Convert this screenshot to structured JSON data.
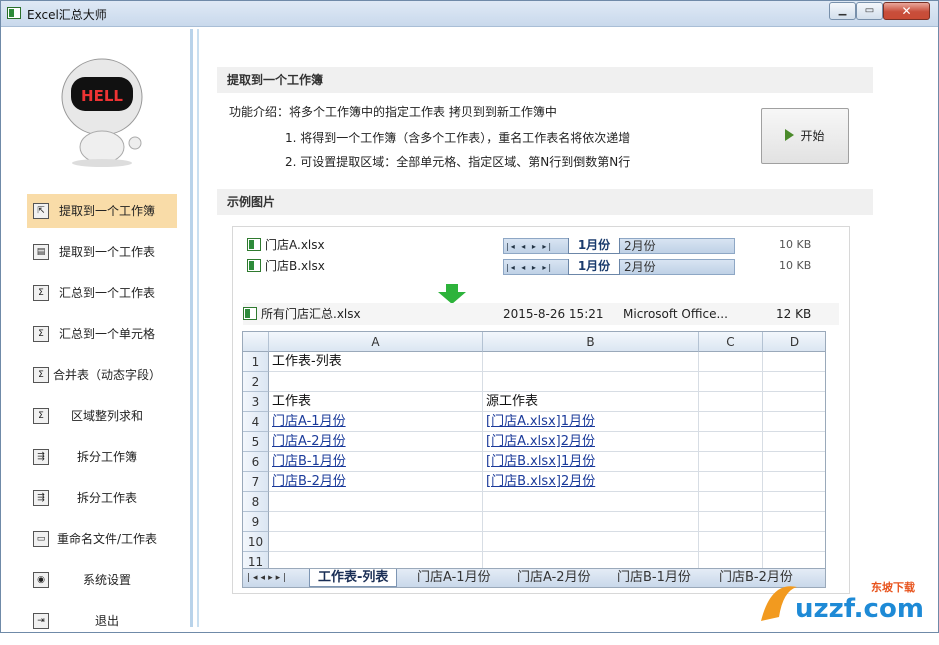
{
  "window": {
    "title": "Excel汇总大师",
    "close_glyph": "✕",
    "min_glyph": "▁",
    "max_glyph": "▭"
  },
  "sidebar": {
    "robot_text": "HELL",
    "items": [
      {
        "label": "提取到一个工作簿",
        "icon": "extract-workbook-icon",
        "glyph": "⇱",
        "active": true
      },
      {
        "label": "提取到一个工作表",
        "icon": "extract-sheet-icon",
        "glyph": "▤"
      },
      {
        "label": "汇总到一个工作表",
        "icon": "sigma-icon",
        "glyph": "Σ"
      },
      {
        "label": "汇总到一个单元格",
        "icon": "sigma-icon",
        "glyph": "Σ"
      },
      {
        "label": "合并表（动态字段）",
        "icon": "sigma-icon",
        "glyph": "Σ"
      },
      {
        "label": "区域整列求和",
        "icon": "sigma-icon",
        "glyph": "Σ"
      },
      {
        "label": "拆分工作簿",
        "icon": "split-icon",
        "glyph": "⇶"
      },
      {
        "label": "拆分工作表",
        "icon": "split-icon",
        "glyph": "⇶"
      },
      {
        "label": "重命名文件/工作表",
        "icon": "rename-icon",
        "glyph": "▭"
      },
      {
        "label": "系统设置",
        "icon": "settings-icon",
        "glyph": "◉"
      },
      {
        "label": "退出",
        "icon": "exit-icon",
        "glyph": "⇥"
      }
    ]
  },
  "main": {
    "section1_title": "提取到一个工作簿",
    "intro": "功能介绍：将多个工作簿中的指定工作表 拷贝到到新工作簿中",
    "bullet1": "1. 将得到一个工作簿（含多个工作表），重名工作表名将依次递增",
    "bullet2": "2. 可设置提取区域：全部单元格、指定区域、第N行到倒数第N行",
    "start_label": "开始",
    "section2_title": "示例图片"
  },
  "example": {
    "files": [
      {
        "name": "门店A.xlsx",
        "tab1": "1月份",
        "tab2": "2月份",
        "size": "10 KB"
      },
      {
        "name": "门店B.xlsx",
        "tab1": "1月份",
        "tab2": "2月份",
        "size": "10 KB"
      }
    ],
    "summary": {
      "name": "所有门店汇总.xlsx",
      "date": "2015-8-26 15:21",
      "type": "Microsoft Office...",
      "size": "12 KB"
    },
    "columns": [
      "A",
      "B",
      "C",
      "D"
    ],
    "rows": [
      {
        "n": "1",
        "a": "工作表-列表",
        "b": "",
        "link": false
      },
      {
        "n": "2",
        "a": "",
        "b": "",
        "link": false
      },
      {
        "n": "3",
        "a": "工作表",
        "b": "源工作表",
        "link": false
      },
      {
        "n": "4",
        "a": "门店A-1月份",
        "b": "[门店A.xlsx]1月份",
        "link": true
      },
      {
        "n": "5",
        "a": "门店A-2月份",
        "b": "[门店A.xlsx]2月份",
        "link": true
      },
      {
        "n": "6",
        "a": "门店B-1月份",
        "b": "[门店B.xlsx]1月份",
        "link": true
      },
      {
        "n": "7",
        "a": "门店B-2月份",
        "b": "[门店B.xlsx]2月份",
        "link": true
      },
      {
        "n": "8",
        "a": "",
        "b": "",
        "link": false
      },
      {
        "n": "9",
        "a": "",
        "b": "",
        "link": false
      },
      {
        "n": "10",
        "a": "",
        "b": "",
        "link": false
      },
      {
        "n": "11",
        "a": "",
        "b": "",
        "link": false
      }
    ],
    "sheet_tabs": [
      "工作表-列表",
      "门店A-1月份",
      "门店A-2月份",
      "门店B-1月份",
      "门店B-2月份"
    ]
  },
  "watermark": {
    "brand": "uzzf.com",
    "tag": "东坡下载"
  }
}
